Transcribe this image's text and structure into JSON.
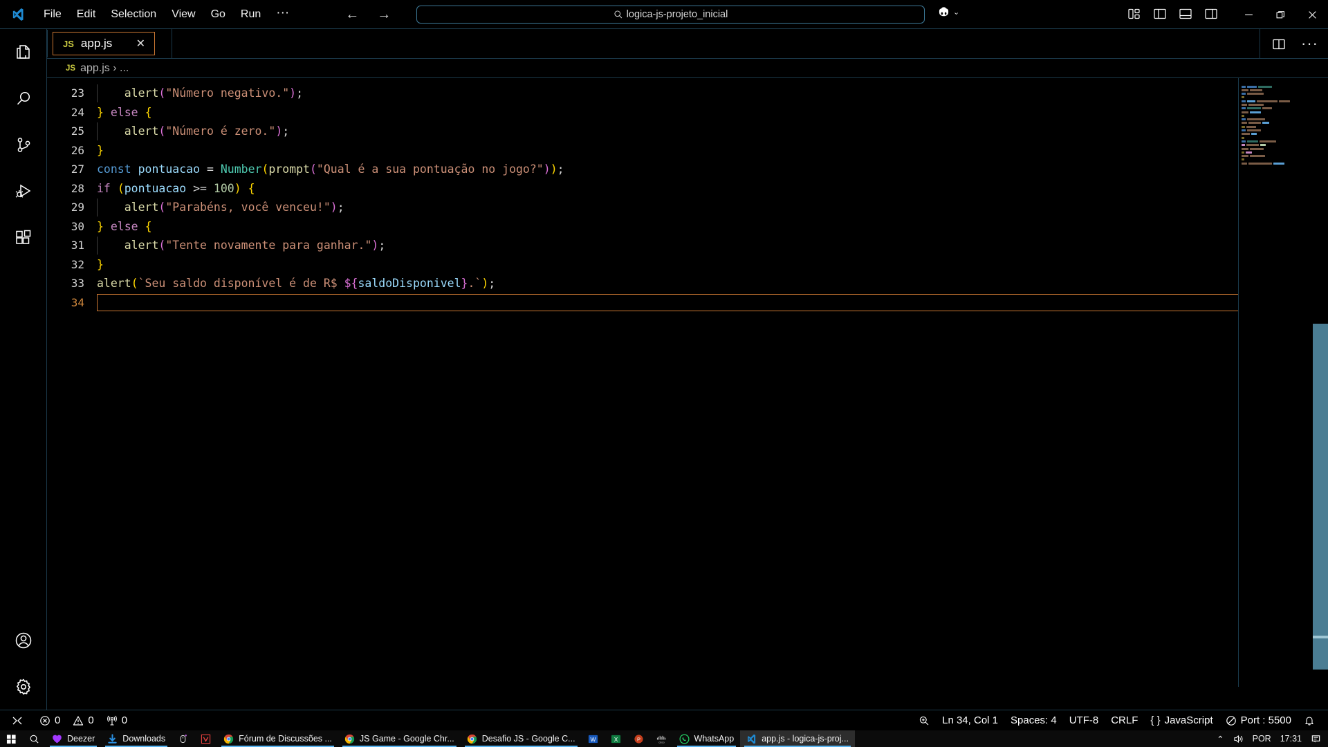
{
  "titlebar": {
    "logo_icon": "vscode-logo-icon",
    "menus": [
      "File",
      "Edit",
      "Selection",
      "View",
      "Go",
      "Run",
      "···"
    ],
    "back_arrow": "←",
    "forward_arrow": "→",
    "search": {
      "value": "logica-js-projeto_inicial",
      "icon": "search-icon"
    },
    "copilot": {
      "icon": "copilot-icon",
      "chevron": "⌄"
    },
    "layout_icons": [
      "customize-layout-icon",
      "toggle-primary-sidebar-icon",
      "toggle-panel-icon",
      "toggle-secondary-sidebar-icon"
    ],
    "window_controls": [
      "minimize-icon",
      "restore-icon",
      "close-icon"
    ]
  },
  "activitybar": {
    "items": [
      {
        "name": "explorer",
        "icon": "files-icon"
      },
      {
        "name": "search",
        "icon": "search-icon"
      },
      {
        "name": "source-control",
        "icon": "source-control-icon"
      },
      {
        "name": "run-and-debug",
        "icon": "run-debug-icon"
      },
      {
        "name": "extensions",
        "icon": "extensions-icon"
      }
    ],
    "bottom": [
      {
        "name": "accounts",
        "icon": "account-icon"
      },
      {
        "name": "settings",
        "icon": "gear-icon"
      }
    ]
  },
  "editor": {
    "tab": {
      "badge": "JS",
      "label": "app.js",
      "close": "✕"
    },
    "actions": {
      "split_icon": "split-editor-icon",
      "more": "···"
    },
    "breadcrumb": {
      "badge": "JS",
      "path": "app.js › ..."
    },
    "active_line": 34,
    "lines": [
      {
        "num": 23,
        "indent_guides": 1,
        "tokens": [
          {
            "t": "    ",
            "c": "t-punc"
          },
          {
            "t": "alert",
            "c": "t-fn"
          },
          {
            "t": "(",
            "c": "t-par2"
          },
          {
            "t": "\"Número negativo.\"",
            "c": "t-str"
          },
          {
            "t": ")",
            "c": "t-par2"
          },
          {
            "t": ";",
            "c": "t-punc"
          }
        ]
      },
      {
        "num": 24,
        "indent_guides": 0,
        "tokens": [
          {
            "t": "}",
            "c": "t-brace-y"
          },
          {
            "t": " ",
            "c": "t-punc"
          },
          {
            "t": "else",
            "c": "t-kw2"
          },
          {
            "t": " ",
            "c": "t-punc"
          },
          {
            "t": "{",
            "c": "t-brace-y"
          }
        ]
      },
      {
        "num": 25,
        "indent_guides": 1,
        "tokens": [
          {
            "t": "    ",
            "c": "t-punc"
          },
          {
            "t": "alert",
            "c": "t-fn"
          },
          {
            "t": "(",
            "c": "t-par2"
          },
          {
            "t": "\"Número é zero.\"",
            "c": "t-str"
          },
          {
            "t": ")",
            "c": "t-par2"
          },
          {
            "t": ";",
            "c": "t-punc"
          }
        ]
      },
      {
        "num": 26,
        "indent_guides": 0,
        "tokens": [
          {
            "t": "}",
            "c": "t-brace-y"
          }
        ]
      },
      {
        "num": 27,
        "indent_guides": 0,
        "tokens": [
          {
            "t": "const",
            "c": "t-kw"
          },
          {
            "t": " ",
            "c": "t-punc"
          },
          {
            "t": "pontuacao",
            "c": "t-var"
          },
          {
            "t": " ",
            "c": "t-punc"
          },
          {
            "t": "=",
            "c": "t-op"
          },
          {
            "t": " ",
            "c": "t-punc"
          },
          {
            "t": "Number",
            "c": "t-cls"
          },
          {
            "t": "(",
            "c": "t-par1"
          },
          {
            "t": "prompt",
            "c": "t-fn"
          },
          {
            "t": "(",
            "c": "t-par2"
          },
          {
            "t": "\"Qual é a sua pontuação no jogo?\"",
            "c": "t-str"
          },
          {
            "t": ")",
            "c": "t-par2"
          },
          {
            "t": ")",
            "c": "t-par1"
          },
          {
            "t": ";",
            "c": "t-punc"
          }
        ]
      },
      {
        "num": 28,
        "indent_guides": 0,
        "tokens": [
          {
            "t": "if",
            "c": "t-kw2"
          },
          {
            "t": " ",
            "c": "t-punc"
          },
          {
            "t": "(",
            "c": "t-par1"
          },
          {
            "t": "pontuacao",
            "c": "t-var"
          },
          {
            "t": " ",
            "c": "t-punc"
          },
          {
            "t": ">=",
            "c": "t-op"
          },
          {
            "t": " ",
            "c": "t-punc"
          },
          {
            "t": "100",
            "c": "t-num"
          },
          {
            "t": ")",
            "c": "t-par1"
          },
          {
            "t": " ",
            "c": "t-punc"
          },
          {
            "t": "{",
            "c": "t-brace-y"
          }
        ]
      },
      {
        "num": 29,
        "indent_guides": 1,
        "tokens": [
          {
            "t": "    ",
            "c": "t-punc"
          },
          {
            "t": "alert",
            "c": "t-fn"
          },
          {
            "t": "(",
            "c": "t-par2"
          },
          {
            "t": "\"Parabéns, você venceu!\"",
            "c": "t-str"
          },
          {
            "t": ")",
            "c": "t-par2"
          },
          {
            "t": ";",
            "c": "t-punc"
          }
        ]
      },
      {
        "num": 30,
        "indent_guides": 0,
        "tokens": [
          {
            "t": "}",
            "c": "t-brace-y"
          },
          {
            "t": " ",
            "c": "t-punc"
          },
          {
            "t": "else",
            "c": "t-kw2"
          },
          {
            "t": " ",
            "c": "t-punc"
          },
          {
            "t": "{",
            "c": "t-brace-y"
          }
        ]
      },
      {
        "num": 31,
        "indent_guides": 1,
        "tokens": [
          {
            "t": "    ",
            "c": "t-punc"
          },
          {
            "t": "alert",
            "c": "t-fn"
          },
          {
            "t": "(",
            "c": "t-par2"
          },
          {
            "t": "\"Tente novamente para ganhar.\"",
            "c": "t-str"
          },
          {
            "t": ")",
            "c": "t-par2"
          },
          {
            "t": ";",
            "c": "t-punc"
          }
        ]
      },
      {
        "num": 32,
        "indent_guides": 0,
        "tokens": [
          {
            "t": "}",
            "c": "t-brace-y"
          }
        ]
      },
      {
        "num": 33,
        "indent_guides": 0,
        "tokens": [
          {
            "t": "alert",
            "c": "t-fn"
          },
          {
            "t": "(",
            "c": "t-par1"
          },
          {
            "t": "`Seu saldo disponível é de R$ ",
            "c": "t-str"
          },
          {
            "t": "${",
            "c": "t-par2"
          },
          {
            "t": "saldoDisponivel",
            "c": "t-var"
          },
          {
            "t": "}",
            "c": "t-par2"
          },
          {
            "t": ".`",
            "c": "t-str"
          },
          {
            "t": ")",
            "c": "t-par1"
          },
          {
            "t": ";",
            "c": "t-punc"
          }
        ]
      },
      {
        "num": 34,
        "indent_guides": 0,
        "tokens": []
      }
    ]
  },
  "statusbar": {
    "left": [
      {
        "name": "remote-indicator",
        "icon": "remote-icon",
        "label": ""
      },
      {
        "name": "problems-errors",
        "icon": "error-icon",
        "label": "0"
      },
      {
        "name": "problems-warnings",
        "icon": "warning-icon",
        "label": "0"
      },
      {
        "name": "ports",
        "icon": "radio-tower-icon",
        "label": "0"
      }
    ],
    "right": [
      {
        "name": "editor-zoom",
        "icon": "zoom-icon",
        "label": ""
      },
      {
        "name": "cursor-position",
        "icon": "",
        "label": "Ln 34, Col 1"
      },
      {
        "name": "indentation",
        "icon": "",
        "label": "Spaces: 4"
      },
      {
        "name": "encoding",
        "icon": "",
        "label": "UTF-8"
      },
      {
        "name": "eol",
        "icon": "",
        "label": "CRLF"
      },
      {
        "name": "language-mode",
        "icon": "braces-icon",
        "label": "JavaScript"
      },
      {
        "name": "live-server-port",
        "icon": "circle-slash-icon",
        "label": "Port : 5500"
      },
      {
        "name": "notifications",
        "icon": "bell-icon",
        "label": ""
      }
    ]
  },
  "taskbar": {
    "items": [
      {
        "name": "start",
        "icon": "windows-icon",
        "label": "",
        "running": false,
        "active": false
      },
      {
        "name": "taskbar-search",
        "icon": "search-icon",
        "label": "",
        "running": false,
        "active": false
      },
      {
        "name": "deezer",
        "icon": "deezer-heart-icon",
        "label": "Deezer",
        "running": true,
        "active": false
      },
      {
        "name": "downloads",
        "icon": "download-arrow-icon",
        "label": "Downloads",
        "running": true,
        "active": false
      },
      {
        "name": "mouse-utility",
        "icon": "mouse-icon",
        "label": "",
        "running": false,
        "active": false
      },
      {
        "name": "vivaldi-app",
        "icon": "red-v-icon",
        "label": "",
        "running": false,
        "active": false
      },
      {
        "name": "chrome-forum",
        "icon": "chrome-icon",
        "label": "Fórum de Discussões ...",
        "running": true,
        "active": false
      },
      {
        "name": "chrome-js-game",
        "icon": "chrome-icon",
        "label": "JS Game - Google Chr...",
        "running": true,
        "active": false
      },
      {
        "name": "chrome-desafio-js",
        "icon": "chrome-icon",
        "label": "Desafio JS - Google C...",
        "running": true,
        "active": false
      },
      {
        "name": "word",
        "icon": "word-icon",
        "label": "",
        "running": false,
        "active": false
      },
      {
        "name": "excel",
        "icon": "excel-icon",
        "label": "",
        "running": false,
        "active": false
      },
      {
        "name": "powerpoint",
        "icon": "powerpoint-icon",
        "label": "",
        "running": false,
        "active": false
      },
      {
        "name": "cisco",
        "icon": "cisco-icon",
        "label": "",
        "running": false,
        "active": false
      },
      {
        "name": "whatsapp",
        "icon": "whatsapp-icon",
        "label": "WhatsApp",
        "running": true,
        "active": false
      },
      {
        "name": "vscode-window",
        "icon": "vscode-logo-icon",
        "label": "app.js - logica-js-proj...",
        "running": true,
        "active": true
      }
    ],
    "tray": {
      "chevron": "⌃",
      "volume_icon": "speaker-icon",
      "language": "POR",
      "time": "17:31",
      "notification_icon": "notification-icon"
    }
  },
  "colors": {
    "accent_border": "#cc7832",
    "panel_border": "#1b3a4b",
    "scrollbar": "#4a7d93",
    "taskbar_running": "#59b4f0"
  }
}
